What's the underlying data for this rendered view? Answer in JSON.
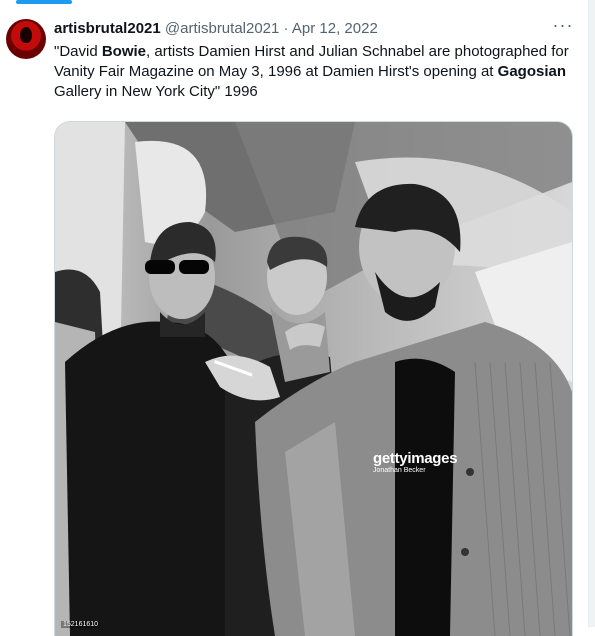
{
  "tweet": {
    "display_name": "artisbrutal2021",
    "handle": "@artisbrutal2021",
    "separator": "·",
    "date": "Apr 12, 2022",
    "more_icon": "more-horizontal-icon",
    "text_parts": {
      "p1": "\"David ",
      "p2": "Bowie",
      "p3": ", artists Damien Hirst and Julian Schnabel are photographed for Vanity Fair Magazine on May 3, 1996 at Damien Hirst's opening at ",
      "p4": "Gagosian",
      "p5": " Gallery in New York City\" 1996"
    },
    "media": {
      "watermark_brand": "gettyimages",
      "watermark_credit": "Jonathan Becker",
      "photo_id": "152161610"
    }
  },
  "colors": {
    "accent": "#1d9bf0",
    "text": "#0f1419",
    "secondary_text": "#536471"
  }
}
